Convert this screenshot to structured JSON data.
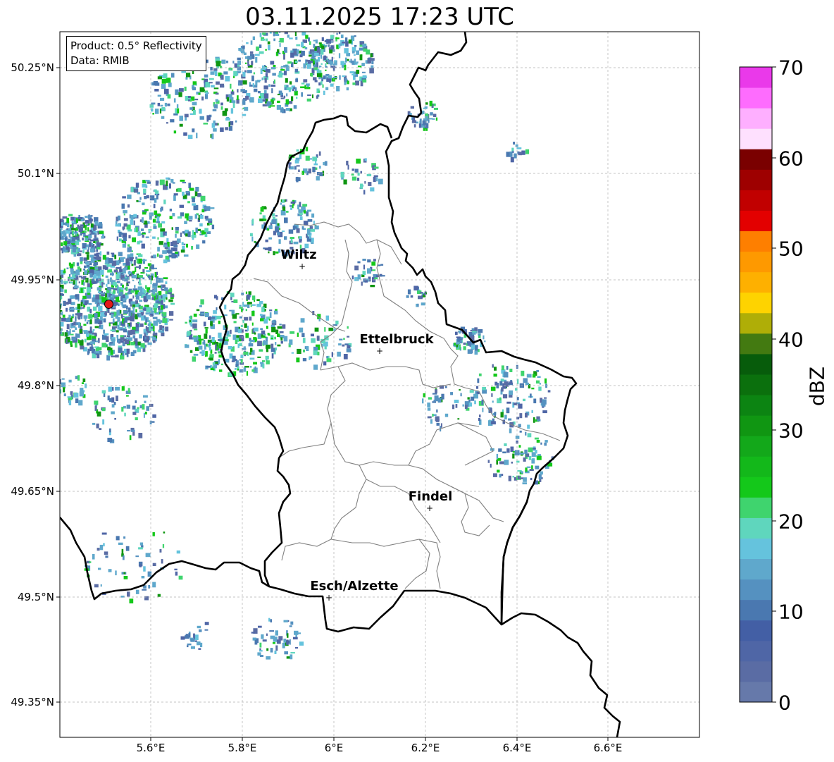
{
  "title": "03.11.2025 17:23 UTC",
  "info": {
    "product": "Product: 0.5° Reflectivity",
    "source": "Data: RMIB"
  },
  "axes": {
    "y_labels": [
      "50.25°N",
      "50.1°N",
      "49.95°N",
      "49.8°N",
      "49.65°N",
      "49.5°N",
      "49.35°N"
    ],
    "x_labels": [
      "5.6°E",
      "5.8°E",
      "6°E",
      "6.2°E",
      "6.4°E",
      "6.6°E"
    ]
  },
  "cities": [
    {
      "name": "Wiltz"
    },
    {
      "name": "Ettelbruck"
    },
    {
      "name": "Findel"
    },
    {
      "name": "Esch/Alzette"
    }
  ],
  "colorbar": {
    "label": "dBZ",
    "ticks": [
      "0",
      "10",
      "20",
      "30",
      "40",
      "50",
      "60",
      "70"
    ],
    "colors": [
      "#6679aa",
      "#5a6ca4",
      "#4f66a6",
      "#435fa5",
      "#4a78b0",
      "#5591c0",
      "#5fa8cc",
      "#65c3dd",
      "#5fd6bd",
      "#3fd46e",
      "#14c81a",
      "#13b81a",
      "#13a81a",
      "#109612",
      "#0c8412",
      "#0b700d",
      "#075c0b",
      "#437a11",
      "#afae07",
      "#fed300",
      "#feb000",
      "#fe9900",
      "#fe7f00",
      "#e30000",
      "#c10000",
      "#9e0000",
      "#7a0000",
      "#fee0fe",
      "#feafff",
      "#fe6cfe",
      "#ea39ea"
    ]
  },
  "colors": {
    "border": "#000000",
    "canton": "#808080",
    "grid": "#b0b0b0"
  }
}
